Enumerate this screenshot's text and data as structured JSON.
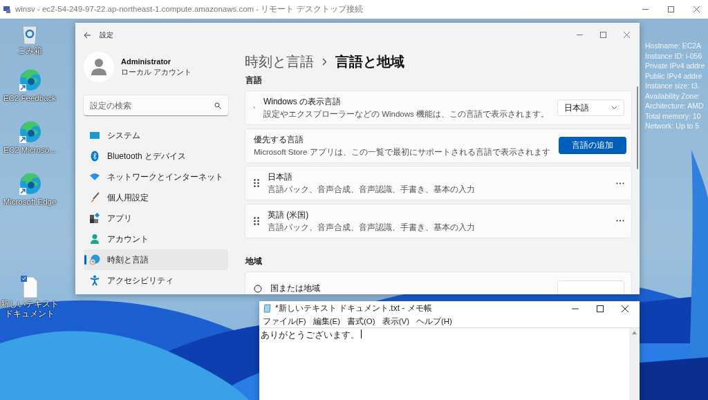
{
  "remote_window": {
    "title": "winsv - ec2-54-249-97-22.ap-northeast-1.compute.amazonaws.com - リモート デスクトップ接続"
  },
  "desktop_icons": [
    {
      "kind": "recycle-bin",
      "label": "ごみ箱"
    },
    {
      "kind": "edge",
      "label": "EC2 Feedback"
    },
    {
      "kind": "edge",
      "label": "EC2 Microso..."
    },
    {
      "kind": "edge",
      "label": "Microsoft Edge"
    },
    {
      "kind": "document",
      "label": "新しいテキストドキュメント"
    }
  ],
  "instance_info": [
    "Hostname: EC2A",
    "Instance ID: i-056",
    "Private IPv4 addre",
    "Public IPv4 addre",
    "Instance size: t3.",
    "Availability Zone:",
    "Architecture: AMD",
    "Total memory: 10",
    "Network: Up to 5"
  ],
  "settings": {
    "title": "設定",
    "user": {
      "name": "Administrator",
      "account": "ローカル アカウント"
    },
    "search": {
      "placeholder": "設定の検索"
    },
    "nav": [
      {
        "kind": "system",
        "label": "システム",
        "selected": false
      },
      {
        "kind": "bluetooth",
        "label": "Bluetooth とデバイス",
        "selected": false
      },
      {
        "kind": "network",
        "label": "ネットワークとインターネット",
        "selected": false
      },
      {
        "kind": "personalization",
        "label": "個人用設定",
        "selected": false
      },
      {
        "kind": "apps",
        "label": "アプリ",
        "selected": false
      },
      {
        "kind": "accounts",
        "label": "アカウント",
        "selected": false
      },
      {
        "kind": "time",
        "label": "時刻と言語",
        "selected": true
      },
      {
        "kind": "accessibility",
        "label": "アクセシビリティ",
        "selected": false
      }
    ],
    "breadcrumb": {
      "parent": "時刻と言語",
      "current": "言語と地域"
    },
    "sections": [
      {
        "title": "言語",
        "cards": [
          {
            "kind": "dropdown",
            "title": "Windows の表示言語",
            "description": "設定やエクスプローラーなどの Windows 機能は、この言語で表示されます。",
            "value": "日本語"
          },
          {
            "kind": "button",
            "title": "優先する言語",
            "description": "Microsoft Store アプリは、この一覧で最初にサポートされる言語で表示されます",
            "button": "言語の追加"
          },
          {
            "kind": "language",
            "title": "日本語",
            "description": "言語パック、音声合成、音声認識、手書き、基本の入力"
          },
          {
            "kind": "language",
            "title": "英語 (米国)",
            "description": "言語パック、音声合成、音声認識、手書き、基本の入力"
          }
        ]
      },
      {
        "title": "地域",
        "cards": [
          {
            "kind": "region",
            "title": "国または地域"
          }
        ]
      }
    ]
  },
  "notepad": {
    "title": "*新しいテキスト ドキュメント.txt - メモ帳",
    "menu": [
      "ファイル(F)",
      "編集(E)",
      "書式(O)",
      "表示(V)",
      "ヘルプ(H)"
    ],
    "text": "ありがとうございます。"
  }
}
